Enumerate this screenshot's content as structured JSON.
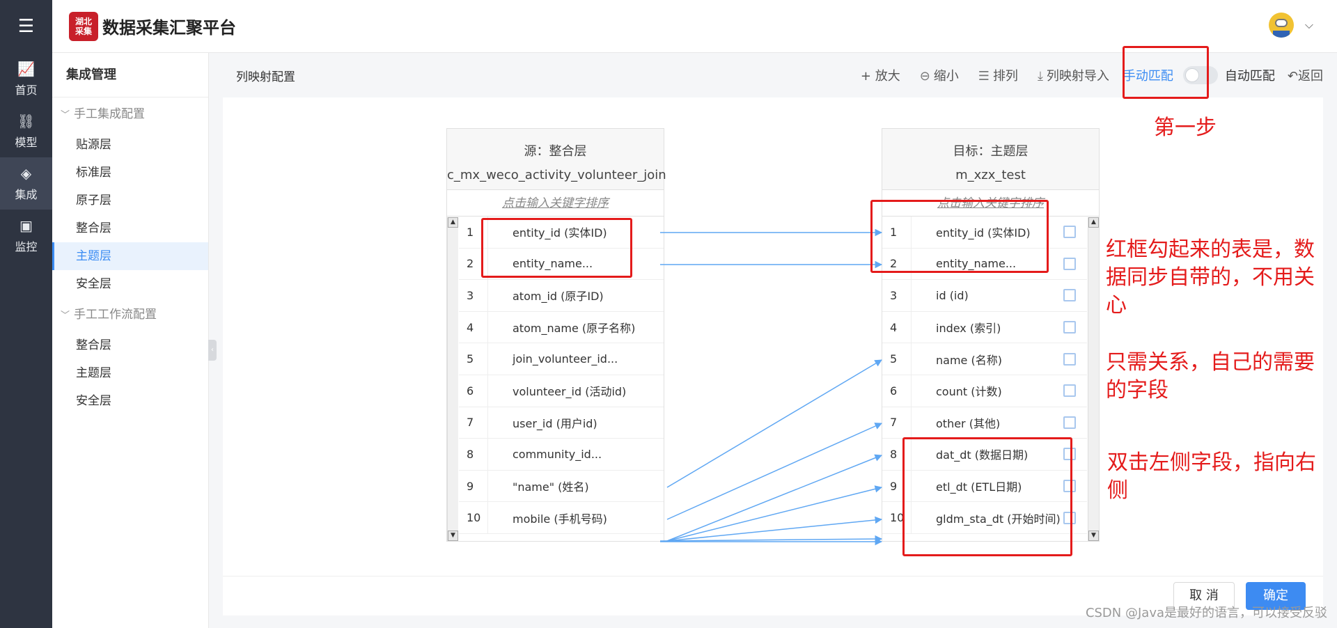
{
  "app": {
    "title": "数据采集汇聚平台",
    "logo_text": "湖北\n采集"
  },
  "leftnav": {
    "items": [
      {
        "label": "首页",
        "icon": "chart-line-icon"
      },
      {
        "label": "模型",
        "icon": "hierarchy-icon"
      },
      {
        "label": "集成",
        "icon": "layers-icon",
        "active": true
      },
      {
        "label": "监控",
        "icon": "monitor-icon"
      }
    ]
  },
  "sidebar": {
    "title": "集成管理",
    "group1": "手工集成配置",
    "group1_items": [
      "贴源层",
      "标准层",
      "原子层",
      "整合层",
      "主题层",
      "安全层"
    ],
    "group2": "手工工作流配置",
    "group2_items": [
      "整合层",
      "主题层",
      "安全层"
    ]
  },
  "header": {
    "page_title": "列映射配置",
    "tools": {
      "zoom_in": "+ 放大",
      "zoom_out": "缩小",
      "sort": "排列",
      "import": "列映射导入",
      "manual": "手动匹配",
      "auto": "自动匹配",
      "back": "返回"
    }
  },
  "source": {
    "title": "源：整合层",
    "table": "c_mx_weco_activity_volunteer_join",
    "search_placeholder": "点击输入关键字排序",
    "rows": [
      {
        "n": "1",
        "field": "entity_id (实体ID)"
      },
      {
        "n": "2",
        "field": "entity_name..."
      },
      {
        "n": "3",
        "field": "atom_id (原子ID)"
      },
      {
        "n": "4",
        "field": "atom_name (原子名称)"
      },
      {
        "n": "5",
        "field": "join_volunteer_id..."
      },
      {
        "n": "6",
        "field": "volunteer_id (活动id)"
      },
      {
        "n": "7",
        "field": "user_id (用户id)"
      },
      {
        "n": "8",
        "field": "community_id..."
      },
      {
        "n": "9",
        "field": "\"name\" (姓名)"
      },
      {
        "n": "10",
        "field": "mobile (手机号码)"
      }
    ]
  },
  "target": {
    "title": "目标：主题层",
    "table": "m_xzx_test",
    "search_placeholder": "点击输入关键字排序",
    "rows": [
      {
        "n": "1",
        "field": "entity_id (实体ID)"
      },
      {
        "n": "2",
        "field": "entity_name..."
      },
      {
        "n": "3",
        "field": "id (id)"
      },
      {
        "n": "4",
        "field": "index (索引)"
      },
      {
        "n": "5",
        "field": "name (名称)"
      },
      {
        "n": "6",
        "field": "count (计数)"
      },
      {
        "n": "7",
        "field": "other (其他)"
      },
      {
        "n": "8",
        "field": "dat_dt (数据日期)"
      },
      {
        "n": "9",
        "field": "etl_dt (ETL日期)"
      },
      {
        "n": "10",
        "field": "gldm_sta_dt (开始时间)"
      }
    ]
  },
  "annotations": {
    "step1": "第一步",
    "note1": "红框勾起来的表是，数据同步自带的，不用关心",
    "note2": "只需关系，自己的需要的字段",
    "note3": "双击左侧字段，指向右侧"
  },
  "footer": {
    "cancel": "取 消",
    "ok": "确定",
    "watermark": "CSDN @Java是最好的语言，可以接受反驳"
  },
  "colors": {
    "accent": "#3b8cf3",
    "annotation": "#e41b1b",
    "nav_bg": "#2e3441",
    "arrow": "#5fa7f3"
  }
}
